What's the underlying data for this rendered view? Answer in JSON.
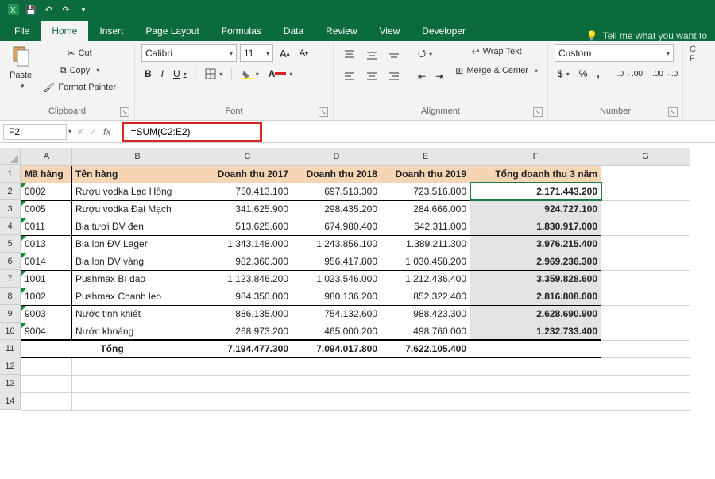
{
  "qat": {
    "save": "💾",
    "undo": "↶",
    "redo": "↷"
  },
  "tabs": [
    "File",
    "Home",
    "Insert",
    "Page Layout",
    "Formulas",
    "Data",
    "Review",
    "View",
    "Developer"
  ],
  "tellme": {
    "icon": "💡",
    "text": "Tell me what you want to"
  },
  "ribbon": {
    "clipboard": {
      "paste": "Paste",
      "cut": "Cut",
      "copy": "Copy",
      "fp": "Format Painter",
      "label": "Clipboard"
    },
    "font": {
      "name": "Calibri",
      "size": "11",
      "label": "Font",
      "btns": {
        "bold": "B",
        "italic": "I",
        "underline": "U"
      }
    },
    "alignment": {
      "wrap": "Wrap Text",
      "merge": "Merge & Center",
      "label": "Alignment"
    },
    "number": {
      "format": "Custom",
      "label": "Number"
    }
  },
  "namebox": "F2",
  "formula": "=SUM(C2:E2)",
  "colHeaders": [
    "A",
    "B",
    "C",
    "D",
    "E",
    "F",
    "G"
  ],
  "rowHeaders": [
    "1",
    "2",
    "3",
    "4",
    "5",
    "6",
    "7",
    "8",
    "9",
    "10",
    "11",
    "12",
    "13",
    "14"
  ],
  "header": {
    "a": "Mã hàng",
    "b": "Tên hàng",
    "c": "Doanh thu 2017",
    "d": "Doanh thu 2018",
    "e": "Doanh thu 2019",
    "f": "Tổng doanh thu 3 năm"
  },
  "rows": [
    {
      "a": "0002",
      "b": "Rượu vodka Lạc Hồng",
      "c": "750.413.100",
      "d": "697.513.300",
      "e": "723.516.800",
      "f": "2.171.443.200"
    },
    {
      "a": "0005",
      "b": "Rượu vodka Đại Mạch",
      "c": "341.625.900",
      "d": "298.435.200",
      "e": "284.666.000",
      "f": "924.727.100"
    },
    {
      "a": "0011",
      "b": "Bia tươi ĐV đen",
      "c": "513.625.600",
      "d": "674.980.400",
      "e": "642.311.000",
      "f": "1.830.917.000"
    },
    {
      "a": "0013",
      "b": "Bia lon ĐV Lager",
      "c": "1.343.148.000",
      "d": "1.243.856.100",
      "e": "1.389.211.300",
      "f": "3.976.215.400"
    },
    {
      "a": "0014",
      "b": "Bia lon ĐV vàng",
      "c": "982.360.300",
      "d": "956.417.800",
      "e": "1.030.458.200",
      "f": "2.969.236.300"
    },
    {
      "a": "1001",
      "b": "Pushmax Bí đao",
      "c": "1.123.846.200",
      "d": "1.023.546.000",
      "e": "1.212.436.400",
      "f": "3.359.828.600"
    },
    {
      "a": "1002",
      "b": "Pushmax Chanh leo",
      "c": "984.350.000",
      "d": "980.136.200",
      "e": "852.322.400",
      "f": "2.816.808.600"
    },
    {
      "a": "9003",
      "b": "Nước tinh khiết",
      "c": "886.135.000",
      "d": "754.132.600",
      "e": "988.423.300",
      "f": "2.628.690.900"
    },
    {
      "a": "9004",
      "b": "Nước khoáng",
      "c": "268.973.200",
      "d": "465.000.200",
      "e": "498.760.000",
      "f": "1.232.733.400"
    }
  ],
  "totals": {
    "label": "Tổng",
    "c": "7.194.477.300",
    "d": "7.094.017.800",
    "e": "7.622.105.400"
  },
  "chart_data": {
    "type": "table",
    "columns": [
      "Mã hàng",
      "Tên hàng",
      "Doanh thu 2017",
      "Doanh thu 2018",
      "Doanh thu 2019",
      "Tổng doanh thu 3 năm"
    ],
    "rows": [
      [
        "0002",
        "Rượu vodka Lạc Hồng",
        750413100,
        697513300,
        723516800,
        2171443200
      ],
      [
        "0005",
        "Rượu vodka Đại Mạch",
        341625900,
        298435200,
        284666000,
        924727100
      ],
      [
        "0011",
        "Bia tươi ĐV đen",
        513625600,
        674980400,
        642311000,
        1830917000
      ],
      [
        "0013",
        "Bia lon ĐV Lager",
        1343148000,
        1243856100,
        1389211300,
        3976215400
      ],
      [
        "0014",
        "Bia lon ĐV vàng",
        982360300,
        956417800,
        1030458200,
        2969236300
      ],
      [
        "1001",
        "Pushmax Bí đao",
        1123846200,
        1023546000,
        1212436400,
        3359828600
      ],
      [
        "1002",
        "Pushmax Chanh leo",
        984350000,
        980136200,
        852322400,
        2816808600
      ],
      [
        "9003",
        "Nước tinh khiết",
        886135000,
        754132600,
        988423300,
        2628690900
      ],
      [
        "9004",
        "Nước khoáng",
        268973200,
        465000200,
        498760000,
        1232733400
      ]
    ],
    "totals": {
      "Doanh thu 2017": 7194477300,
      "Doanh thu 2018": 7094017800,
      "Doanh thu 2019": 7622105400
    }
  }
}
